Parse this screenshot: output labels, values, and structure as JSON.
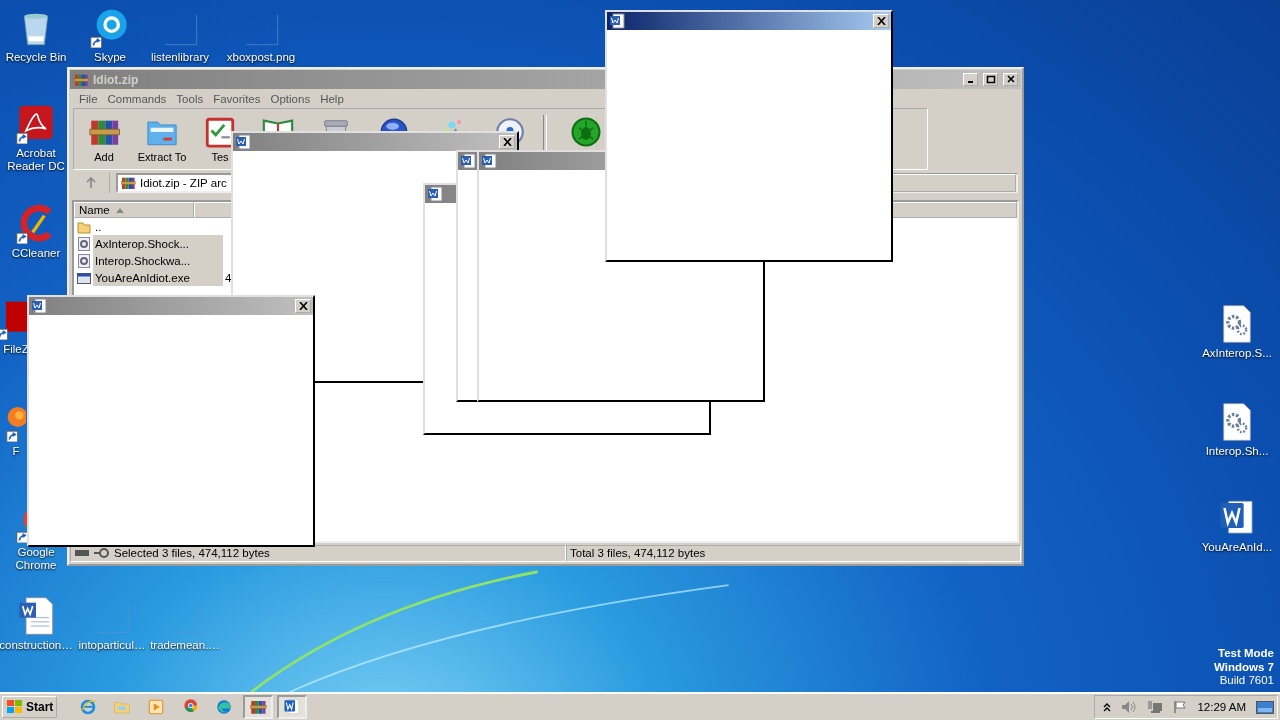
{
  "desktop_icons": [
    {
      "label": "Recycle Bin",
      "kind": "recycle-bin"
    },
    {
      "label": "Skype",
      "kind": "skype"
    },
    {
      "label": "listenlibrary",
      "kind": "blank"
    },
    {
      "label": "xboxpost.png",
      "kind": "blank"
    },
    {
      "label": "Acrobat Reader DC",
      "kind": "acrobat"
    },
    {
      "label": "CCleaner",
      "kind": "ccleaner"
    },
    {
      "label": "FileZ",
      "kind": "filezilla"
    },
    {
      "label": "F",
      "kind": "firefox"
    },
    {
      "label": "Google Chrome",
      "kind": "chrome"
    },
    {
      "label": "construction…",
      "kind": "word-doc"
    },
    {
      "label": "intoparticul…",
      "kind": "blank"
    },
    {
      "label": "trademean.…",
      "kind": "blank"
    },
    {
      "label": "AxInterop.S...",
      "kind": "gear-file"
    },
    {
      "label": "Interop.Sh...",
      "kind": "gear-file"
    },
    {
      "label": "YouAreAnId...",
      "kind": "word"
    }
  ],
  "archiver_window": {
    "title": "Idiot.zip",
    "menu": [
      "File",
      "Commands",
      "Tools",
      "Favorites",
      "Options",
      "Help"
    ],
    "toolbar": [
      {
        "label": "Add",
        "kind": "add"
      },
      {
        "label": "Extract To",
        "kind": "extract"
      },
      {
        "label": "Tes",
        "kind": "test"
      },
      {
        "kind": "view"
      },
      {
        "kind": "delete"
      },
      {
        "kind": "find"
      },
      {
        "kind": "wizard"
      },
      {
        "kind": "info"
      },
      {
        "kind": "virus"
      }
    ],
    "path": "Idiot.zip - ZIP arc",
    "columns": [
      "Name"
    ],
    "rows": [
      {
        "name": "..",
        "kind": "parent",
        "selected": false
      },
      {
        "name": "AxInterop.Shock...",
        "kind": "dll",
        "selected": true
      },
      {
        "name": "Interop.Shockwa...",
        "kind": "dll",
        "selected": true
      },
      {
        "name": "YouAreAnIdiot.exe",
        "kind": "exe",
        "selected": true,
        "size": "4"
      }
    ],
    "status_left": "Selected 3 files, 474,112 bytes",
    "status_right": "Total 3 files, 474,112 bytes"
  },
  "popups": [
    {
      "active": false,
      "closable": true
    },
    {
      "active": false,
      "closable": false
    },
    {
      "active": false,
      "closable": false
    },
    {
      "active": false,
      "closable": false
    },
    {
      "active": true,
      "closable": true
    },
    {
      "active": false,
      "closable": true
    }
  ],
  "taskbar": {
    "start": "Start",
    "apps": [
      {
        "kind": "ie",
        "pressed": false
      },
      {
        "kind": "explorer",
        "pressed": false
      },
      {
        "kind": "media",
        "pressed": false
      },
      {
        "kind": "chrome",
        "pressed": false
      },
      {
        "kind": "edge",
        "pressed": false
      },
      {
        "kind": "winrar",
        "pressed": true
      },
      {
        "kind": "word",
        "pressed": true
      }
    ],
    "clock": "12:29 AM"
  },
  "test_mode_notice": [
    "Test Mode",
    "Windows 7",
    "Build 7601"
  ]
}
